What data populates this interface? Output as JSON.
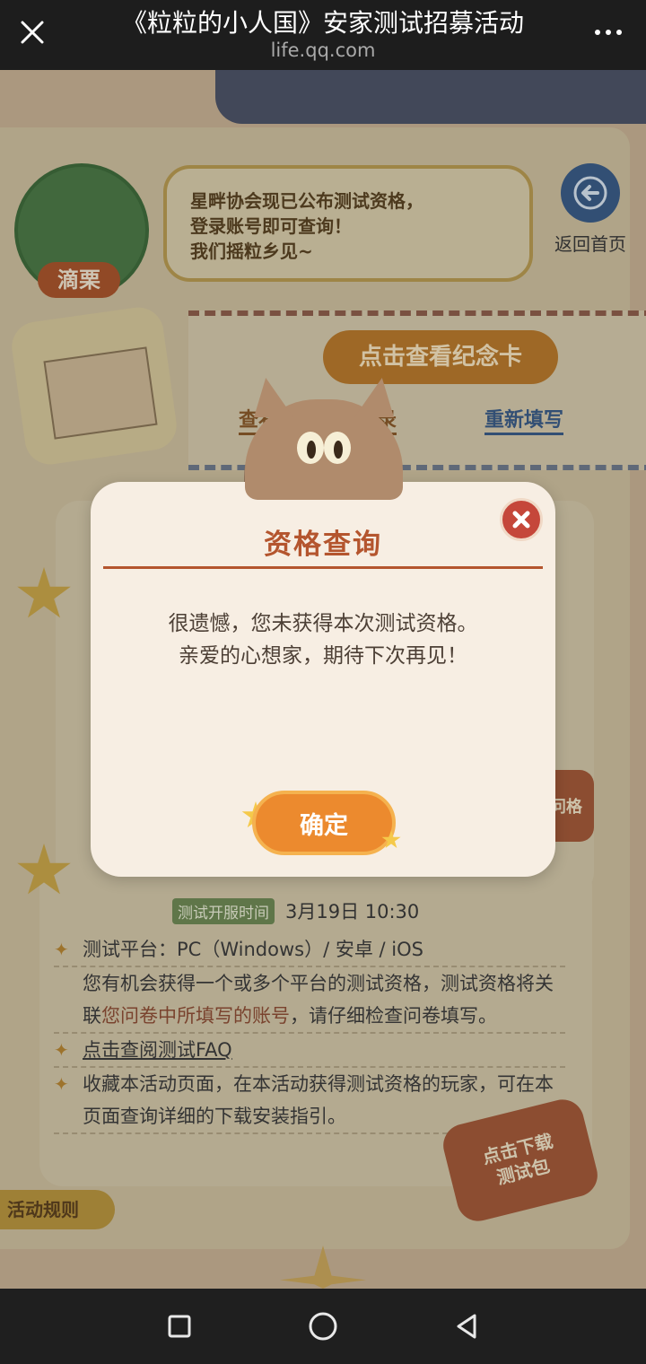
{
  "browser": {
    "title": "《粒粒的小人国》安家测试招募活动",
    "url": "life.qq.com"
  },
  "page": {
    "speech_lines": [
      "星畔协会现已公布测试资格，",
      "登录账号即可查询！",
      "我们摇粒乡见~"
    ],
    "avatar_name": "滴栗",
    "back_home_label": "返回首页",
    "memorial_card_button": "点击查看纪念卡",
    "view_record_link": "查看问卷填写记录",
    "refill_link": "重新填写",
    "side_badge": "问格",
    "test_time_tag": "测试开服时间",
    "test_time_value": "3月19日  10:30",
    "info": {
      "line1": "测试平台：PC（Windows）/ 安卓 / iOS",
      "line2_a": "您有机会获得一个或多个平台的测试资格，测试资格将关联",
      "line2_highlight": "您问卷中所填写的账号",
      "line2_b": "，请仔细检查问卷填写。",
      "line3": "点击查阅测试FAQ",
      "line4": "收藏本活动页面，在本活动获得测试资格的玩家，可在本页面查询详细的下载安装指引。"
    },
    "download_badge": "点击下载\n测试包",
    "rules_tab": "活动规则"
  },
  "modal": {
    "title": "资格查询",
    "message_line1": "很遗憾，您未获得本次测试资格。",
    "message_line2": "亲爱的心想家，期待下次再见！",
    "confirm_label": "确定"
  },
  "colors": {
    "accent_orange": "#ec8a2e",
    "modal_title": "#b4552e",
    "close_red": "#c5473a",
    "back_blue": "#3b5d88"
  }
}
